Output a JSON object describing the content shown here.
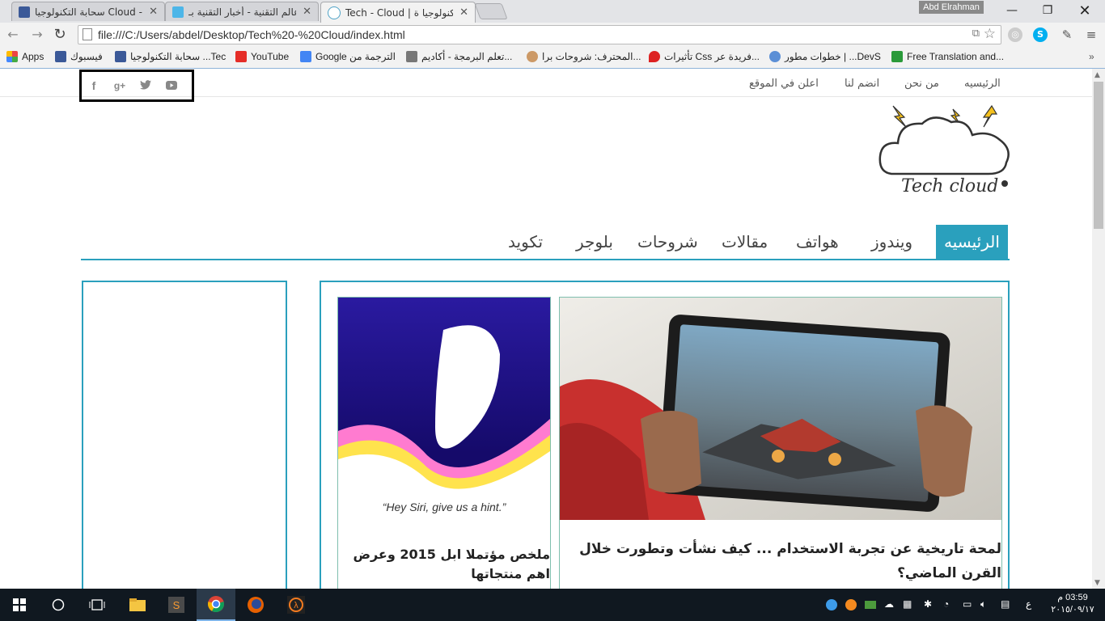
{
  "browser": {
    "tabs": [
      {
        "title": "سحابة التكنولوجيا Cloud - h"
      },
      {
        "title": "عالم التقنية - أخبار التقنية بـ"
      },
      {
        "title": "Tech - Cloud | التكنولوجيا ة"
      }
    ],
    "profile_name": "Abd Elrahman",
    "url": "file:///C:/Users/abdel/Desktop/Tech%20-%20Cloud/index.html",
    "bookmarks": [
      {
        "label": "Apps"
      },
      {
        "label": "فيسبوك"
      },
      {
        "label": "سحابة التكنولوجيا ...Tec"
      },
      {
        "label": "YouTube"
      },
      {
        "label": "Google الترجمة من"
      },
      {
        "label": "تعلم البرمجة - أكاديم..."
      },
      {
        "label": "المحترف: شروحات برا..."
      },
      {
        "label": "تأثيرات Css فريدة عر..."
      },
      {
        "label": "خطوات مطور | ...DevS"
      },
      {
        "label": "Free Translation and..."
      }
    ]
  },
  "page": {
    "top_links": [
      "الرئيسيه",
      "من نحن",
      "انضم لنا",
      "اعلن في الموقع"
    ],
    "social": [
      "facebook-icon",
      "google-plus-icon",
      "twitter-icon",
      "youtube-icon"
    ],
    "logo_text": "Tech cloud",
    "main_nav": [
      "الرئيسيه",
      "ويندوز",
      "هواتف",
      "مقالات",
      "شروحات",
      "بلوجر",
      "تكويد"
    ],
    "active_nav": "الرئيسيه",
    "accent_color": "#2aa0bd",
    "articles": [
      {
        "title": "لمحة تاريخية عن تجربة الاستخدام ... كيف نشأت وتطورت خلال القرن الماضي؟"
      },
      {
        "title": "ملخص مؤتملا ابل 2015 وعرض اهم منتجاتها",
        "image_caption": "“Hey Siri, give us a hint.”"
      }
    ]
  },
  "taskbar": {
    "clock_time": "03:59 م",
    "clock_date": "٢٠١٥/٠٩/١٧",
    "lang": "ع"
  }
}
